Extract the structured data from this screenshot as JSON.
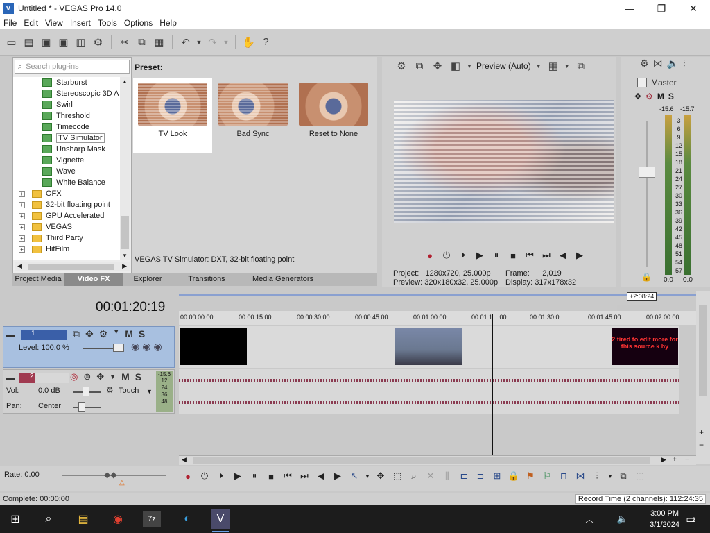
{
  "window": {
    "title": "Untitled * - VEGAS Pro 14.0",
    "logo": "V",
    "minimize": "—",
    "maximize": "❐",
    "close": "✕"
  },
  "menu": [
    "File",
    "Edit",
    "View",
    "Insert",
    "Tools",
    "Options",
    "Help"
  ],
  "plugins": {
    "search_placeholder": "Search plug-ins",
    "tree": [
      {
        "label": "Starburst",
        "kind": "plug"
      },
      {
        "label": "Stereoscopic 3D A",
        "kind": "plug"
      },
      {
        "label": "Swirl",
        "kind": "plug"
      },
      {
        "label": "Threshold",
        "kind": "plug"
      },
      {
        "label": "Timecode",
        "kind": "plug"
      },
      {
        "label": "TV Simulator",
        "kind": "plug",
        "selected": true
      },
      {
        "label": "Unsharp Mask",
        "kind": "plug"
      },
      {
        "label": "Vignette",
        "kind": "plug"
      },
      {
        "label": "Wave",
        "kind": "plug"
      },
      {
        "label": "White Balance",
        "kind": "plug"
      },
      {
        "label": "OFX",
        "kind": "folder"
      },
      {
        "label": "32-bit floating point",
        "kind": "folder"
      },
      {
        "label": "GPU Accelerated",
        "kind": "folder"
      },
      {
        "label": "VEGAS",
        "kind": "folder"
      },
      {
        "label": "Third Party",
        "kind": "folder"
      },
      {
        "label": "HitFilm",
        "kind": "folder"
      }
    ]
  },
  "presets": {
    "label": "Preset:",
    "items": [
      {
        "label": "TV Look",
        "selected": true
      },
      {
        "label": "Bad Sync",
        "selected": false
      },
      {
        "label": "Reset to None",
        "selected": false
      }
    ],
    "description": "VEGAS TV Simulator: DXT, 32-bit floating point"
  },
  "tabs": [
    {
      "label": "Project Media",
      "active": false
    },
    {
      "label": "Video FX",
      "active": true
    },
    {
      "label": "Explorer",
      "active": false
    },
    {
      "label": "Transitions",
      "active": false
    },
    {
      "label": "Media Generators",
      "active": false
    }
  ],
  "preview": {
    "mode": "Preview (Auto)",
    "project_label": "Project:",
    "project_value": "1280x720, 25.000p",
    "preview_label": "Preview:",
    "preview_value": "320x180x32, 25.000p",
    "frame_label": "Frame:",
    "frame_value": "2,019",
    "display_label": "Display:",
    "display_value": "317x178x32"
  },
  "master": {
    "label": "Master",
    "m": "M",
    "s": "S",
    "peak_left": "-15.6",
    "peak_right": "-15.7",
    "scale": [
      "3",
      "6",
      "9",
      "12",
      "15",
      "18",
      "21",
      "24",
      "27",
      "30",
      "33",
      "36",
      "39",
      "42",
      "45",
      "48",
      "51",
      "54",
      "57"
    ],
    "value_left": "0.0",
    "value_right": "0.0"
  },
  "timeline": {
    "time": "00:01:20:19",
    "tooltip": "+2:08:24",
    "ruler": [
      "00:00:00:00",
      "00:00:15:00",
      "00:00:30:00",
      "00:00:45:00",
      "00:01:00:00",
      "00:01:1",
      ":00",
      "00:01:30:0",
      "00:01:45:00",
      "00:02:00:00"
    ]
  },
  "track1": {
    "number": "1",
    "level": "Level: 100.0 %",
    "m": "M",
    "s": "S"
  },
  "track2": {
    "number": "2",
    "vol_label": "Vol:",
    "vol_value": "0.0 dB",
    "pan_label": "Pan:",
    "pan_value": "Center",
    "touch": "Touch",
    "m": "M",
    "s": "S",
    "meter_peak": "-15.6",
    "meter_scale": [
      "12",
      "24",
      "36",
      "48"
    ]
  },
  "clip_end_text": "2 tired to edit more for this source k hy",
  "bottom": {
    "rate": "Rate: 0.00"
  },
  "status": {
    "left": "Complete: 00:00:00",
    "right": "Record Time (2 channels): 112:24:35"
  },
  "taskbar": {
    "time": "3:00 PM",
    "date": "3/1/2024",
    "notif_count": "2"
  }
}
